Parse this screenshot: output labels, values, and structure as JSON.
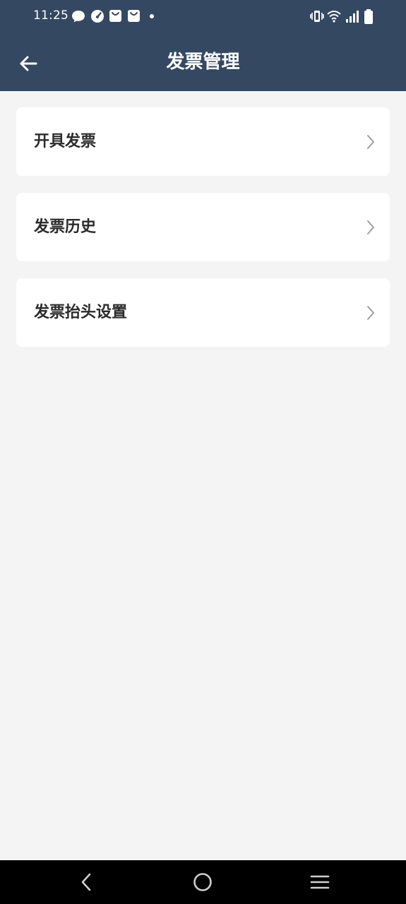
{
  "status_bar": {
    "time": "11:25",
    "left_icons": [
      "chat-bubble-icon",
      "speedometer-icon",
      "shopping-bag-icon",
      "shopping-bag-icon",
      "dot-icon"
    ],
    "right_icons": [
      "vibrate-icon",
      "wifi-icon",
      "signal-icon",
      "battery-icon"
    ]
  },
  "header": {
    "title": "发票管理",
    "back_icon": "arrow-left-icon",
    "background_color": "#344862"
  },
  "menu": {
    "items": [
      {
        "label": "开具发票",
        "icon": "chevron-right-icon"
      },
      {
        "label": "发票历史",
        "icon": "chevron-right-icon"
      },
      {
        "label": "发票抬头设置",
        "icon": "chevron-right-icon"
      }
    ]
  },
  "nav_bar": {
    "buttons": [
      "back-triangle-icon",
      "home-circle-icon",
      "recents-menu-icon"
    ]
  }
}
